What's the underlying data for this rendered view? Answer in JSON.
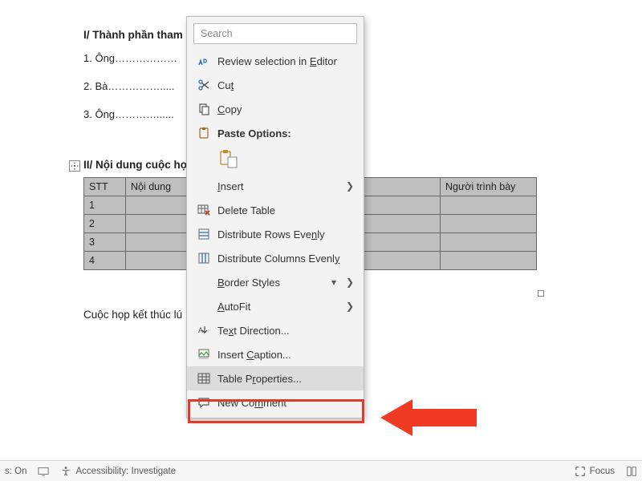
{
  "doc": {
    "section1_title": "I/ Thành phần tham",
    "lines": [
      "1. Ông………………",
      "2. Bà…………….....",
      "3. Ông…………......"
    ],
    "section2_title": "II/ Nội dung cuộc họ",
    "closing": "Cuộc họp kết thúc lú"
  },
  "table": {
    "headers": [
      "STT",
      "Nội dung",
      "",
      "Người trình bày"
    ],
    "rows": [
      [
        "1",
        "",
        "",
        ""
      ],
      [
        "2",
        "",
        "",
        ""
      ],
      [
        "3",
        "",
        "",
        ""
      ],
      [
        "4",
        "",
        "",
        ""
      ]
    ]
  },
  "context_menu": {
    "search_placeholder": "Search",
    "review": "Review selection in Editor",
    "cut": "Cut",
    "copy": "Copy",
    "paste_options": "Paste Options:",
    "insert": "Insert",
    "delete_table": "Delete Table",
    "dist_rows": "Distribute Rows Evenly",
    "dist_cols": "Distribute Columns Evenly",
    "border_styles": "Border Styles",
    "autofit": "AutoFit",
    "text_direction": "Text Direction...",
    "insert_caption": "Insert Caption...",
    "table_properties": "Table Properties...",
    "new_comment": "New Comment"
  },
  "status": {
    "left1": "s: On",
    "accessibility": "Accessibility: Investigate",
    "focus": "Focus"
  }
}
